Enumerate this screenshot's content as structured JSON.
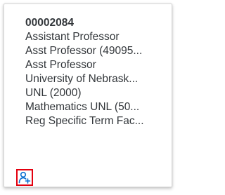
{
  "card": {
    "position_id": "00002084",
    "lines": [
      "Assistant Professor",
      "Asst Professor (49095...",
      "Asst Professor",
      "University of Nebrask...",
      "UNL (2000)",
      "Mathematics UNL (50...",
      "Reg Specific Term Fac..."
    ]
  },
  "actions": {
    "add_person_icon": "add-person-icon",
    "highlight_color": "#e3000f",
    "icon_color": "#0a6ed1"
  }
}
